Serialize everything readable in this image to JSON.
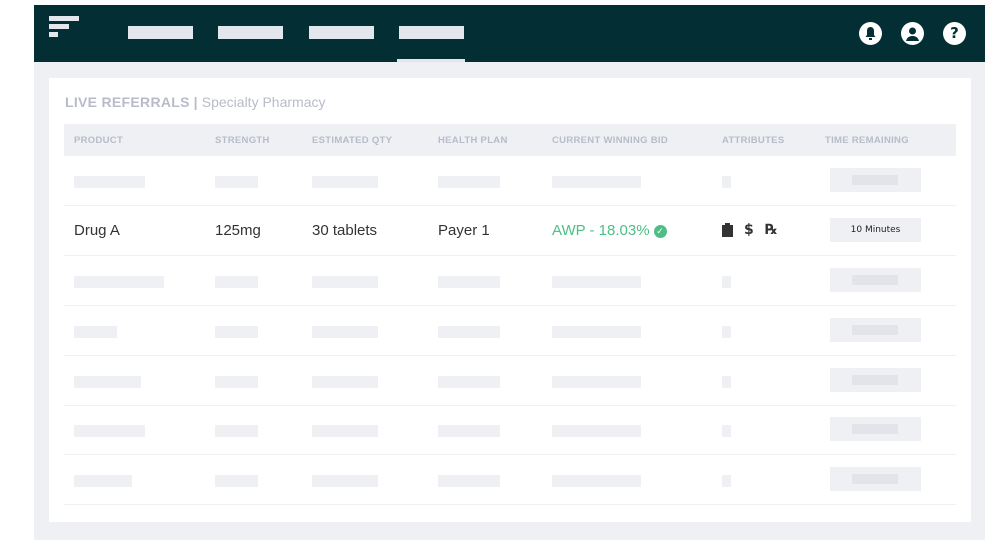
{
  "header": {
    "icons": [
      "bell-icon",
      "user-icon",
      "help-icon"
    ],
    "help_glyph": "?"
  },
  "page": {
    "title_bold": "LIVE REFERRALS",
    "separator": "|",
    "title_sub": "Specialty Pharmacy"
  },
  "table": {
    "columns": [
      "PRODUCT",
      "STRENGTH",
      "ESTIMATED QTY",
      "HEALTH PLAN",
      "CURRENT WINNING BID",
      "ATTRIBUTES",
      "TIME REMAINING"
    ],
    "row": {
      "product": "Drug A",
      "strength": "125mg",
      "qty": "30 tablets",
      "plan": "Payer 1",
      "bid": "AWP - 18.03%",
      "check": "✓",
      "attr_dollar": "$",
      "attr_rx": "℞",
      "time": "10 Minutes"
    }
  },
  "colors": {
    "nav": "#032e33",
    "accent": "#4cbf84"
  }
}
